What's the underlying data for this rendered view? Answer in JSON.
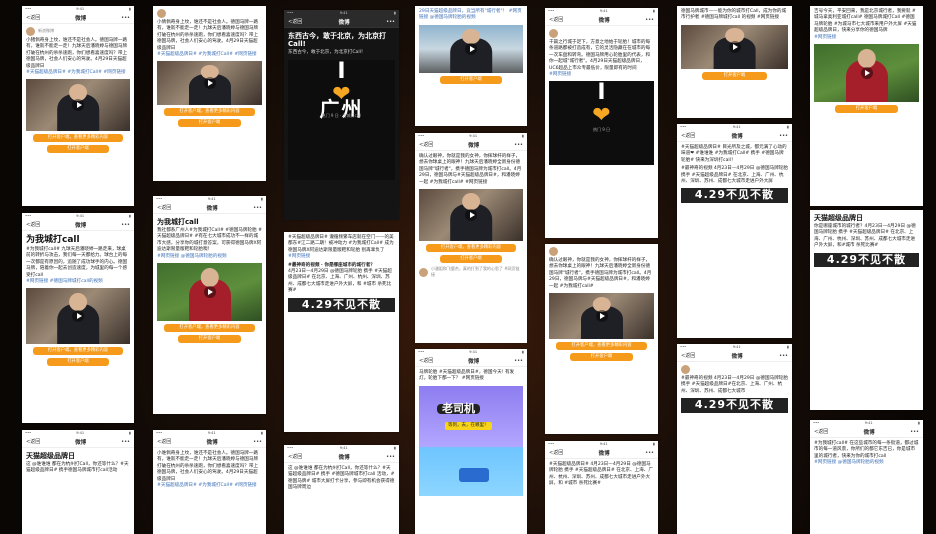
{
  "common": {
    "back": "<返回",
    "weibo": "微博",
    "more": "•••",
    "open_btn": "打开客户端",
    "open_all_btn": "打开客户端，查看更多精彩内容",
    "hashtag_tmall": "#天猫超级品牌日",
    "slogan_429": "4.29不见不散"
  },
  "shots": [
    {
      "id": "a",
      "meta": "新浪微博",
      "text": "小猪佩奇身上纹，谁还不是社会人。德国马牌一路有，谁就不能走一走！九球天后潘晓婷与德国马牌打破在杭州的杀杀速跑，你们想看喜速度吗？带上德国马牌，社会人们安心的驾驶。4月29日天猫超级品牌日",
      "tags": "#天猫超级品牌日# #为我城打Call# #网页链接",
      "btn": "打开客户端，查看更多精彩内容"
    },
    {
      "id": "b",
      "title": "为我城打call",
      "text": "#为我城打call# 九球天后潘晓婷一路走来，球桌前的转折与攻击，我们每一天都给力。球台上的每一次都是有原因的，追随了成功球手的内心。德国马牌，陪着你一起去创造速度，为城里的每一个感受打call",
      "tags": "#网页链接 #德国马牌城打call的视频"
    },
    {
      "id": "c",
      "title": "天猫超级品牌日",
      "text": "这 @谁谁谁 都在为杭州打Call，你还等什么？#天猫超级品牌日# 携手德国马牌城市打call活动"
    },
    {
      "id": "d",
      "text": "小倩佩奇身上纹，谁还不是社会人。德国马牌一路有，谁就不能走一走！九球天后潘晓婷与德国马牌打破在杭州的杀杀速跑，你们想看喜速度吗？带上德国马牌，社会人们安心的驾驶。4月29日天猫超级品牌日",
      "tags": "#天猫超级品牌日# #为我城打Call# #网页链接"
    },
    {
      "id": "e",
      "title": "为我城打call",
      "text": "我社都系广州人#为我城打Call# #德国马牌轮胎 #天猫超级品牌日# #有在七大城市成功不一样的城市大感，分享你的城打意答案，可获得德国马牌X阿迪达斯限量版鞋和轮胎噢！",
      "tags": "#网页链接 @德国马牌轮胎的视频"
    },
    {
      "id": "f",
      "text": "小谁佩奇身上纹，谁还不是社会人。德国马牌一路有，谁就不能走一走！九球天后潘晓婷与德国马牌打破在杭州的杀杀速跑，你们想看喜速度吗？带上德国马牌，社会人们安心的驾驶。4月29日天猫超级品牌日",
      "tags": "#天猫超级品牌日# #为我城打Call# #网页链接"
    },
    {
      "id": "g",
      "title": "东西古今，敢于北京，为北京打Call!",
      "text": "东西古今，敢于北京，为北京打Call！",
      "poster_i": "I",
      "poster_city": "广州",
      "poster_side": "热门 9 日 · 为城打call"
    },
    {
      "id": "h",
      "text": "#天猫超级品牌日# 遵循频繁车店就在空门——的美都东#江二路二期！被冲动力 #为我城打Call# 成为德国马牌X阿迪达斯限量版鞋和轮胎 别再辜负了",
      "tags": "#网页链接",
      "title2": "#最神奇的视频 · 你是哪座城市的城行者？",
      "text2": "4月23日—4月29日 @德国马牌轮胎 携手 #天猫超级品牌日# 在北京、上海、广州、杭州、深圳、苏州、成都七大城市走进户外大屏，和 #城市 杀死比赛#",
      "slogan": "4.29不见不散"
    },
    {
      "id": "i",
      "title": "天猫超级品牌日",
      "text": "这 @谁谁谁 都在为杭州打Call，你还等什么？#天猫超级品牌日# 携手 #德国马牌城市打call 活动，#德国马牌# 城市大屏打卡分享，参与即有机会获得德国马牌周边"
    },
    {
      "id": "j",
      "text": "29日天猫超级品牌日，竞当所有\"城行者\"！ #网页链接 @德国马牌轮胎的视频",
      "btn": "打开客户端"
    },
    {
      "id": "k",
      "text": "确认过眼神，你就是我的女神，你挥球杆的样子，想去你球桌上的眼神！九球天后潘晓婷全新身份德国马牌\"城行者\"，携手德国马牌为城市打call。4月29日，德国马牌与#天猫超级品牌日#，和潘晓婷一起 #为我城打call# #网页链接",
      "bottom_meta": "小潘姐和飞鹿杰，真的打到了我的心思了 #网页链接"
    },
    {
      "id": "l",
      "text": "马牌轮胎 #天猫超级品牌日#，德国今天! 有发灯。轮胎下都一下？ #网页链接",
      "cartoon_main": "老司机",
      "cartoon_sub": "等到，去，在哪里！",
      "bottom_meta": "小潘姐和飞鹿杰，真的打到了我的心思了"
    },
    {
      "id": "m",
      "text": "干篇之行城于足下，方意之地始于轮胎！城市的每条道路都被打造成有，它的灵活隐藏在在城市的每一次车盘和转弯。德国马牌用心轮胎里的代表，和你一起城\"城行者\"。4月29日天猫超级品牌日，UC6超品上市众专最低价，限量即有的时间",
      "tags": "#网页链接",
      "poster_i": "I",
      "poster_side": "热门 9 日"
    },
    {
      "id": "n",
      "text": "确认过眼神，你就是我的女神，你挥球杆的样子，想去你球桌上的眼神！九球天后潘晓婷全新身份德国马牌\"城行者\"，携手德国马牌为城市打call。4月29日，德国马牌与#天猫超级品牌日#，和潘晓婷一起 #为我城打call#"
    },
    {
      "id": "o",
      "text": "#天猫超级品牌日# 4月23日—4月29日 @德国马牌轮胎 携手 #天猫超级品牌日# 在北京、上海、广州、杭州、深圳、苏州、成都七大城市走进户外大屏，和 #城市 杀死比赛#"
    },
    {
      "id": "p",
      "text": "德国马牌城市——能为你的城市打Call，成为你的城市行护者 #德国马牌城打call 的视频 #网页链接"
    },
    {
      "id": "q",
      "text": "#天猫超级品牌日# 目光所及之城，都元满了心动的味道❤ #谁谁谁 #为我城打Call# 携手 #德国马牌轮胎# 快来为深圳打call！",
      "text2": "#最神奇的视频 4月23日—4月29日 @德国马牌轮胎 携手 #天猫超级品牌日# 在北京、上海、广州、杭州、深圳、苏州、成都七大城市走进户外大屏",
      "slogan": "4.29不见不散"
    },
    {
      "id": "r",
      "text": "#最神奇的视频 4月23日—4月29日 @德国马牌轮胎 携手 #天猫超级品牌日#在北京、上海、广州、杭州、深圳、苏州、成都七大城市",
      "slogan": "4.29不见不散"
    },
    {
      "id": "s",
      "text": "吉号今天，平安回来，我是北京城行者，我要就 #城马拿奥利亚城打call# 德国马牌城打Call #德国马牌轮胎 #为城马市七大城市来用户外大屏 #天猫超级品牌日，快来分享你的德国马牌",
      "tags": "#网页链接"
    },
    {
      "id": "t",
      "title": "天猫超级品牌日",
      "text": "你是哪座城市的城行者？4月23日—4月29日 @德国马牌轮胎 携手 #天猫超级品牌日# 在北京、上海、广州、杭州、深圳、苏州、成都七大城市走进户外大屏，和#城市 杀死比赛#",
      "slogan": "4.29不见不散"
    },
    {
      "id": "u",
      "text": "#为我城打call# 在这些城市的每一条街道，都过城市的每一道风景，你所们的都它东吉已，你是城市里的城行者，快来为你的城市打call",
      "tags": "#网页链接 @德国马牌轮胎的视频"
    }
  ]
}
